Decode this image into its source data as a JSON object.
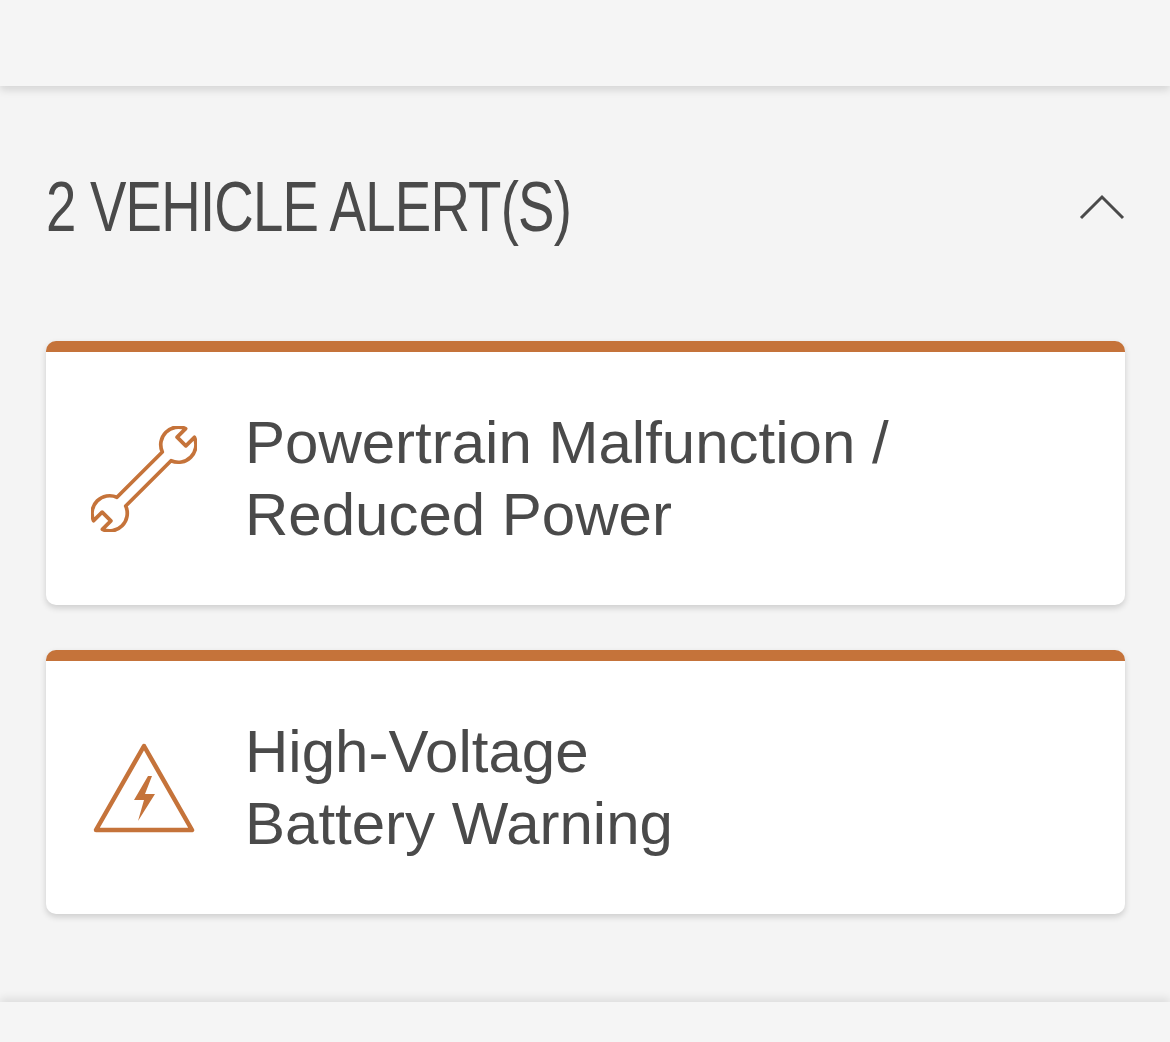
{
  "alerts": {
    "heading": "2 VEHICLE ALERT(S)",
    "expanded": true,
    "items": [
      {
        "kind": "service",
        "title": "Powertrain Malfunction /\nReduced Power"
      },
      {
        "kind": "high_voltage",
        "title": "High-Voltage\nBattery Warning"
      }
    ]
  }
}
